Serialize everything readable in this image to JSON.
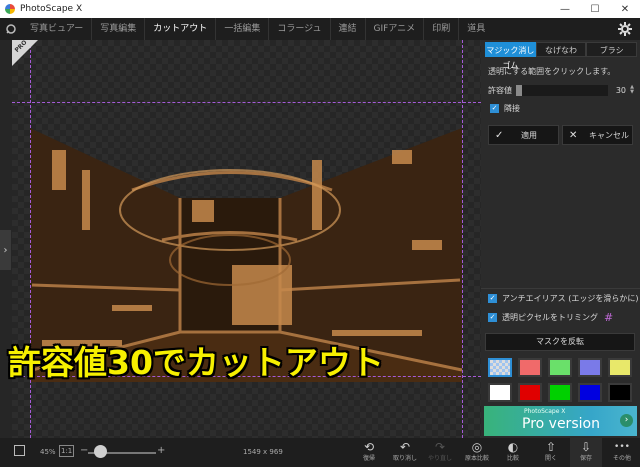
{
  "window": {
    "title": "PhotoScape X",
    "minimize": "—",
    "maximize": "☐",
    "close": "✕"
  },
  "menu": {
    "items": [
      "写真ビュアー",
      "写真編集",
      "カットアウト",
      "一括編集",
      "コラージュ",
      "連結",
      "GIFアニメ",
      "印刷",
      "道具"
    ],
    "active_index": 2
  },
  "canvas": {
    "pro_badge": "PRO",
    "caption": "許容値30でカットアウト"
  },
  "panel": {
    "tabs": [
      "マジック消しゴム",
      "なげなわ",
      "ブラシ"
    ],
    "active_tab": 0,
    "hint": "透明にする範囲をクリックします。",
    "tolerance_label": "許容値",
    "tolerance_value": "30",
    "contiguous_label": "隣接",
    "apply_label": "適用",
    "cancel_label": "キャンセル",
    "antialias_label": "アンチエイリアス (エッジを滑らかに)",
    "trim_label": "透明ピクセルをトリミング",
    "invert_mask_label": "マスクを反転",
    "swatch_colors": [
      "checker",
      "#f06a6a",
      "#6ae06a",
      "#7a7ae8",
      "#e8e86a",
      "#ffffff",
      "#e00000",
      "#00d000",
      "#0000e0",
      "#000000"
    ],
    "pro_banner_small": "PhotoScape X",
    "pro_banner_big": "Pro version"
  },
  "bottom": {
    "zoom": "45%",
    "actual_size": "1:1",
    "minus": "−",
    "plus": "+",
    "dimensions": "1549 x 969",
    "tools": [
      {
        "icon": "undo-all-icon",
        "glyph": "⟲",
        "label": "復帰"
      },
      {
        "icon": "undo-icon",
        "glyph": "↶",
        "label": "取り消し"
      },
      {
        "icon": "redo-icon",
        "glyph": "↷",
        "label": "やり直し"
      },
      {
        "icon": "compare-original-icon",
        "glyph": "◎",
        "label": "原本比較"
      },
      {
        "icon": "compare-icon",
        "glyph": "◐",
        "label": "比較"
      },
      {
        "icon": "open-icon",
        "glyph": "⇧",
        "label": "開く"
      },
      {
        "icon": "save-icon",
        "glyph": "⇩",
        "label": "保存"
      },
      {
        "icon": "more-icon",
        "glyph": "•••",
        "label": "その他"
      }
    ]
  }
}
